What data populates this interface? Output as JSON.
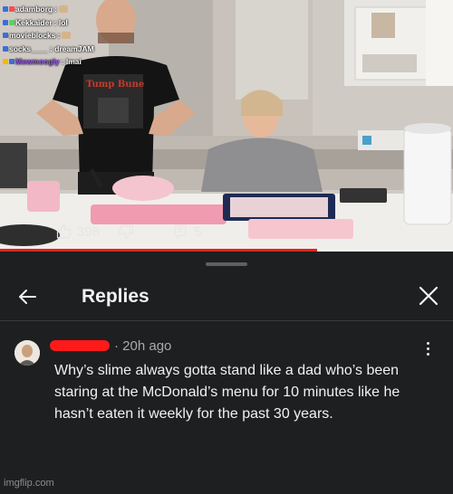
{
  "stream_chat": [
    {
      "user": "adamborg",
      "message": "",
      "color": "#ffffff"
    },
    {
      "user": "Kekkaider",
      "message": "lol",
      "color": "#ffffff"
    },
    {
      "user": "movieblocks",
      "message": "",
      "color": "#ffffff"
    },
    {
      "user": "socks____",
      "message": "dreamJAM",
      "color": "#ffffff"
    },
    {
      "user": "Mewmoogly",
      "message": "lmai",
      "color": "#9b4dff"
    }
  ],
  "video": {
    "progress_fraction": 0.7
  },
  "panel": {
    "title": "Replies",
    "back_icon": "arrow-left-icon",
    "close_icon": "close-icon"
  },
  "comment": {
    "time": "20h ago",
    "text": "Why’s slime always gotta stand like a dad who’s been staring at the McDonald’s menu for 10 minutes like he hasn’t eaten it weekly for the past 30 years.",
    "like_count": "398",
    "reply_count": "5"
  },
  "watermark": "imgflip.com",
  "colors": {
    "panel_bg": "#1e1f21",
    "text": "#f1f1f1",
    "muted": "#aaaaaa",
    "redaction": "#ff1a1a",
    "progress": "#e0241b"
  }
}
